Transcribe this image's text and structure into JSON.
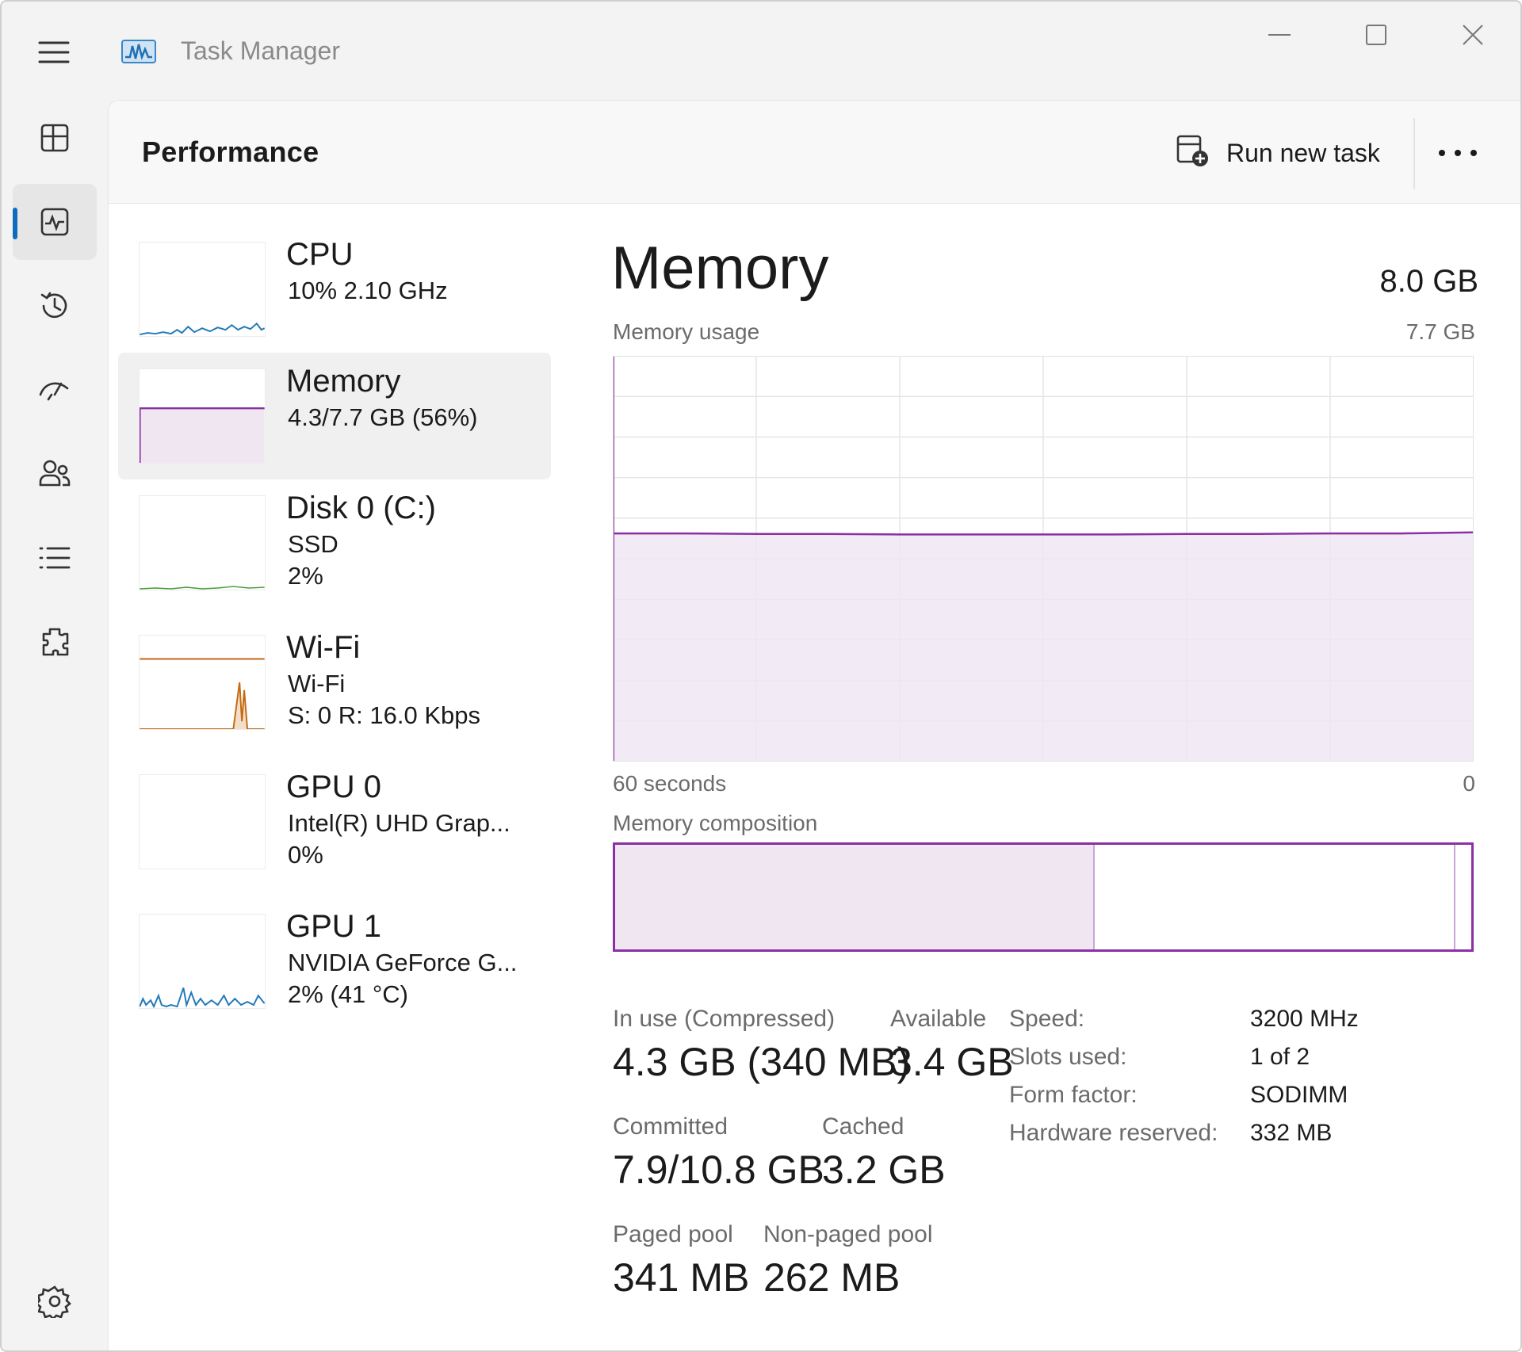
{
  "app": {
    "title": "Task Manager"
  },
  "header": {
    "page_title": "Performance",
    "run_task_label": "Run new task"
  },
  "devices": [
    {
      "name": "CPU",
      "line1": "10%  2.10 GHz",
      "line2": ""
    },
    {
      "name": "Memory",
      "line1": "4.3/7.7 GB (56%)",
      "line2": ""
    },
    {
      "name": "Disk 0 (C:)",
      "line1": "SSD",
      "line2": "2%"
    },
    {
      "name": "Wi-Fi",
      "line1": "Wi-Fi",
      "line2": "S: 0  R: 16.0 Kbps"
    },
    {
      "name": "GPU 0",
      "line1": "Intel(R) UHD Grap...",
      "line2": "0%"
    },
    {
      "name": "GPU 1",
      "line1": "NVIDIA GeForce G...",
      "line2": "2%  (41 °C)"
    }
  ],
  "memory": {
    "title": "Memory",
    "total": "8.0 GB",
    "usage_label": "Memory usage",
    "usage_max": "7.7 GB",
    "x_left": "60 seconds",
    "x_right": "0",
    "composition_label": "Memory composition",
    "in_use_label": "In use (Compressed)",
    "in_use_value": "4.3 GB (340 MB)",
    "available_label": "Available",
    "available_value": "3.4 GB",
    "committed_label": "Committed",
    "committed_value": "7.9/10.8 GB",
    "cached_label": "Cached",
    "cached_value": "3.2 GB",
    "paged_label": "Paged pool",
    "paged_value": "341 MB",
    "nonpaged_label": "Non-paged pool",
    "nonpaged_value": "262 MB",
    "props": [
      {
        "key": "Speed:",
        "value": "3200 MHz"
      },
      {
        "key": "Slots used:",
        "value": "1 of 2"
      },
      {
        "key": "Form factor:",
        "value": "SODIMM"
      },
      {
        "key": "Hardware reserved:",
        "value": "332 MB"
      }
    ]
  },
  "chart_data": {
    "type": "area",
    "ylabel": "Memory usage",
    "ylim": [
      0,
      7.7
    ],
    "xlim": [
      60,
      0
    ],
    "x": [
      60,
      55,
      50,
      45,
      40,
      35,
      30,
      25,
      20,
      15,
      10,
      5,
      0
    ],
    "series": [
      {
        "values": [
          4.33,
          4.33,
          4.32,
          4.32,
          4.31,
          4.31,
          4.31,
          4.31,
          4.32,
          4.32,
          4.33,
          4.33,
          4.35
        ]
      }
    ],
    "grid": true,
    "composition": {
      "in_use_fraction": 0.56,
      "modified_fraction": 0.02
    }
  },
  "colors": {
    "memory_accent": "#8b2fa5",
    "memory_fill": "#efe6f2",
    "cpu_line": "#1f7ab8",
    "wifi_line": "#c46a12",
    "selected_indicator": "#0f6cbd"
  },
  "nav_icons": [
    "processes-icon",
    "performance-icon",
    "app-history-icon",
    "startup-apps-icon",
    "users-icon",
    "details-icon",
    "services-icon",
    "settings-icon"
  ]
}
